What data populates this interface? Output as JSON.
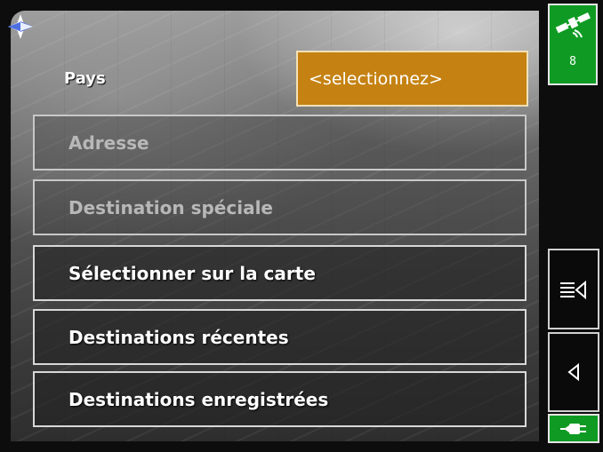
{
  "country": {
    "label": "Pays",
    "value": "<selectionnez>"
  },
  "menu": [
    {
      "label": "Adresse",
      "enabled": false
    },
    {
      "label": "Destination spéciale",
      "enabled": false
    },
    {
      "label": "Sélectionner sur la carte",
      "enabled": true
    },
    {
      "label": "Destinations récentes",
      "enabled": true
    },
    {
      "label": "Destinations enregistrées",
      "enabled": true
    }
  ],
  "status": {
    "satellite_count": "8",
    "gps_color": "#0f9b23",
    "power_color": "#0f9b23"
  },
  "icons": {
    "compass": "compass-icon",
    "satellite": "satellite-icon",
    "menu": "menu-list-icon",
    "back": "back-arrow-icon",
    "power": "power-plug-icon"
  },
  "colors": {
    "select_bg": "#c58212",
    "background": "#0d0d0d"
  }
}
